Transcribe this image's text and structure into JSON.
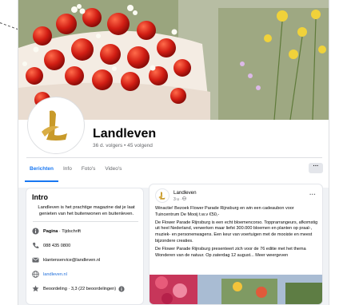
{
  "page": {
    "name": "Landleven",
    "stats": "36 d. volgers • 45 volgend"
  },
  "tabs": [
    {
      "label": "Berichten",
      "active": true
    },
    {
      "label": "Info",
      "active": false
    },
    {
      "label": "Foto's",
      "active": false
    },
    {
      "label": "Video's",
      "active": false
    }
  ],
  "more_label": "···",
  "intro": {
    "title": "Intro",
    "description": "Landleven is het prachtige magazine dat je laat genieten van het buitenwonen en buitenleven.",
    "rows": [
      {
        "icon": "info-icon",
        "bold": "Pagina",
        "text": " · Tijdschrift"
      },
      {
        "icon": "phone-icon",
        "bold": "",
        "text": "088 435 0800"
      },
      {
        "icon": "email-icon",
        "bold": "",
        "text": "klantenservice@landleven.nl"
      },
      {
        "icon": "globe-icon",
        "bold": "",
        "text": "landleven.nl"
      },
      {
        "icon": "star-icon",
        "bold": "",
        "text": "Beoordeling · 3,3 (22 beoordelingen)"
      }
    ]
  },
  "post": {
    "author": "Landleven",
    "time": "3 u · ",
    "more": "···",
    "paragraphs": [
      "Winactie! Bezoek Flower Parade Rijnsburg en win een cadeaubon voor Tuincentrum De Mooij t.w.v €50,-",
      "De Flower Parade Rijnsburg is een echt bloemencorso. Topprarrangeurs, afkomstig uit heel Nederland, verwerken maar liefst 300.000 bloemen en planten op praal-, muziek- en personenwagens. Een keur van voertuigen met de mooiste en meest bijzondere creaties.",
      "De Flower Parade Rijnsburg presenteert zich voor de 76 editie met het thema Wonderen van de natuur. Op zaterdag 12 august... Meer weergeven"
    ]
  },
  "colors": {
    "accent": "#1877f2",
    "logo_gold": "#c89a2a",
    "background": "#f0f2f5"
  }
}
